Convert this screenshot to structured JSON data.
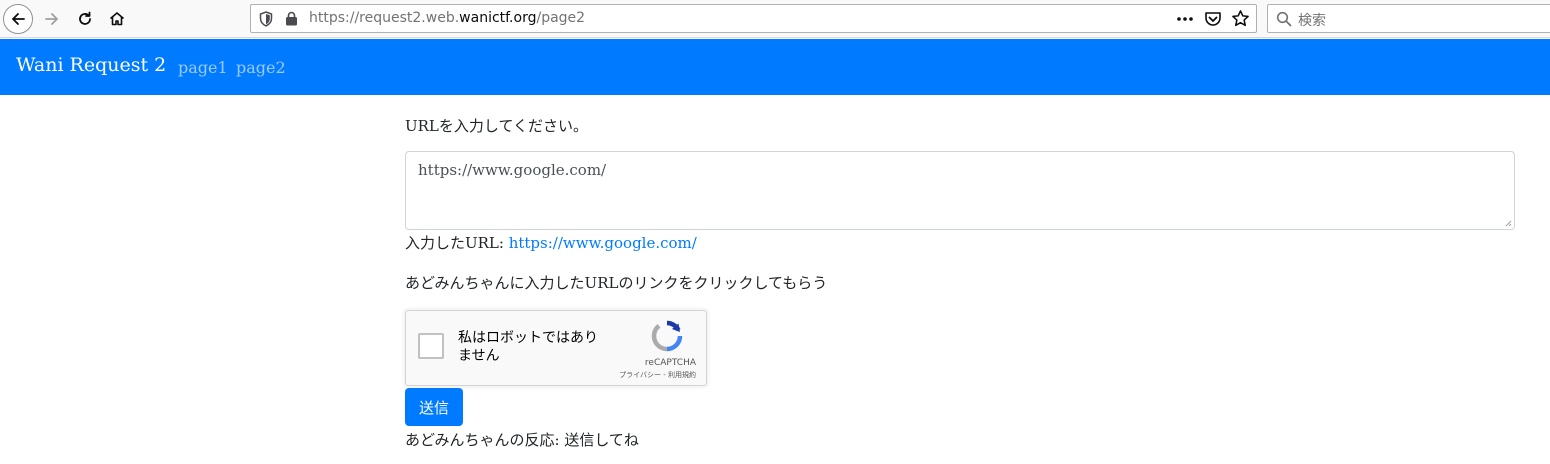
{
  "browser": {
    "url": {
      "prefix": "https://request2.web.",
      "domain": "wanictf.org",
      "path": "/page2"
    },
    "search_placeholder": "検索"
  },
  "navbar": {
    "brand": "Wani Request 2",
    "links": [
      "page1",
      "page2"
    ]
  },
  "main": {
    "prompt": "URLを入力してください。",
    "textarea_value": "https://www.google.com/",
    "entered_label": "入力したURL: ",
    "entered_url": "https://www.google.com/",
    "instruction": "あどみんちゃんに入力したURLのリンクをクリックしてもらう",
    "recaptcha": {
      "label": "私はロボットではありません",
      "brand": "reCAPTCHA",
      "links": "プライバシー - 利用規約"
    },
    "submit_label": "送信",
    "reaction": "あどみんちゃんの反応: 送信してね"
  },
  "colors": {
    "navbar": "#007bff",
    "link": "#007bff",
    "button": "#007bff"
  }
}
